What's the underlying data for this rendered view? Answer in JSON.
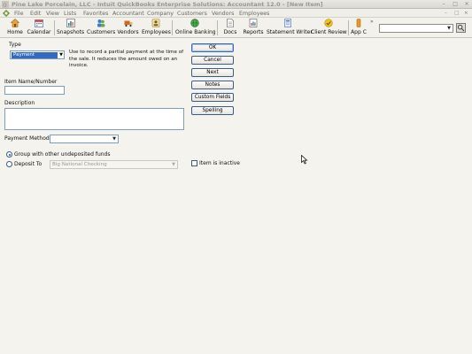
{
  "window": {
    "title": "Pine Lake Porcelain, LLC - Intuit QuickBooks Enterprise Solutions: Accountant 12.0 - [New Item]",
    "controls": [
      "–",
      "□",
      "×"
    ]
  },
  "menubar": {
    "items": [
      "File",
      "Edit",
      "View",
      "Lists",
      "Favorites",
      "Accountant",
      "Company",
      "Customers",
      "Vendors",
      "Employees"
    ],
    "mdi_controls": [
      "–",
      "□",
      "×"
    ]
  },
  "toolbar": {
    "buttons": [
      {
        "label": "Home",
        "icon": "house-icon"
      },
      {
        "label": "Calendar",
        "icon": "calendar-icon"
      },
      {
        "label": "Snapshots",
        "icon": "chart-icon"
      },
      {
        "label": "Customers",
        "icon": "people-icon"
      },
      {
        "label": "Vendors",
        "icon": "truck-icon"
      },
      {
        "label": "Employees",
        "icon": "badge-icon"
      },
      {
        "label": "Online Banking",
        "icon": "globe-icon"
      },
      {
        "label": "Docs",
        "icon": "document-icon"
      },
      {
        "label": "Reports",
        "icon": "report-icon"
      },
      {
        "label": "Statement Writer",
        "icon": "statement-icon"
      },
      {
        "label": "Client Review",
        "icon": "review-icon"
      },
      {
        "label": "App C",
        "icon": "app-icon"
      }
    ],
    "overflow_label": "»",
    "search_value": ""
  },
  "form": {
    "type_label": "Type",
    "type_value": "Payment",
    "type_description": "Use to record a partial payment at the time of the sale. It reduces the amount owed on an invoice.",
    "item_name_label": "Item Name/Number",
    "item_name_value": "",
    "description_label": "Description",
    "description_value": "",
    "payment_method_label": "Payment Method",
    "payment_method_value": "",
    "group_label": "Group with other undeposited funds",
    "group_checked": true,
    "deposit_to_label": "Deposit To",
    "deposit_to_value": "Big National Checking",
    "inactive_label": "Item is inactive"
  },
  "buttons": {
    "ok": "OK",
    "cancel": "Cancel",
    "next": "Next",
    "notes": "Notes",
    "custom_fields": "Custom Fields",
    "spelling": "Spelling"
  },
  "colors": {
    "selection": "#316ac5",
    "title_text": "#9a9890"
  }
}
